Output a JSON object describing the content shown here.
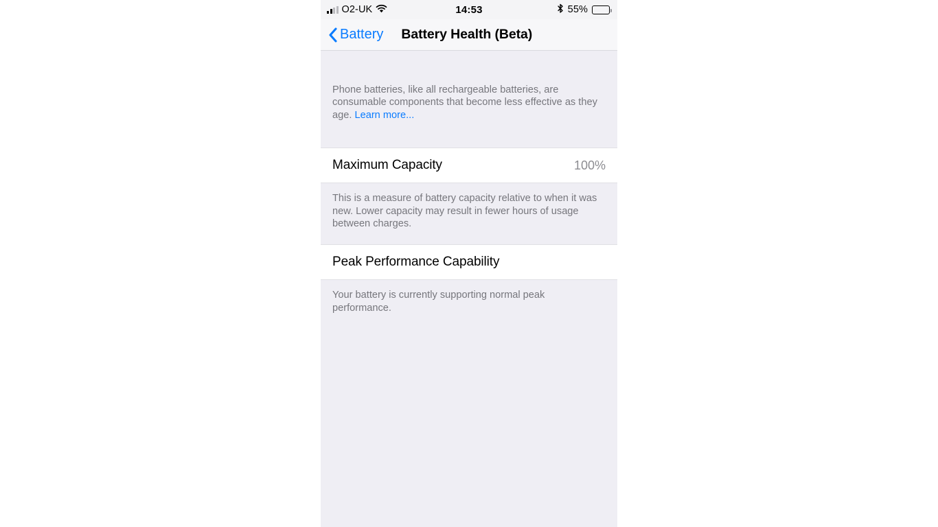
{
  "status_bar": {
    "carrier": "O2-UK",
    "signal_icon": "signal-bars-icon",
    "wifi_icon": "wifi-icon",
    "time": "14:53",
    "bluetooth_icon": "bluetooth-icon",
    "battery_percent_label": "55%",
    "battery_level": 55,
    "battery_icon": "battery-icon"
  },
  "nav_bar": {
    "back_label": "Battery",
    "back_icon": "chevron-left-icon",
    "title": "Battery Health (Beta)",
    "accent_color": "#0a7cff"
  },
  "intro": {
    "text": "Phone batteries, like all rechargeable batteries, are consumable components that become less effective as they age.",
    "link_label": "Learn more..."
  },
  "maximum_capacity": {
    "label": "Maximum Capacity",
    "value": "100%"
  },
  "capacity_description": {
    "text": "This is a measure of battery capacity relative to when it was new. Lower capacity may result in fewer hours of usage between charges."
  },
  "peak_performance": {
    "label": "Peak Performance Capability"
  },
  "peak_performance_description": {
    "text": "Your battery is currently supporting normal peak performance."
  },
  "colors": {
    "background_gray": "#efeef4",
    "row_white": "#ffffff",
    "secondary_text": "#76767c",
    "accent_blue": "#0a7cff"
  }
}
